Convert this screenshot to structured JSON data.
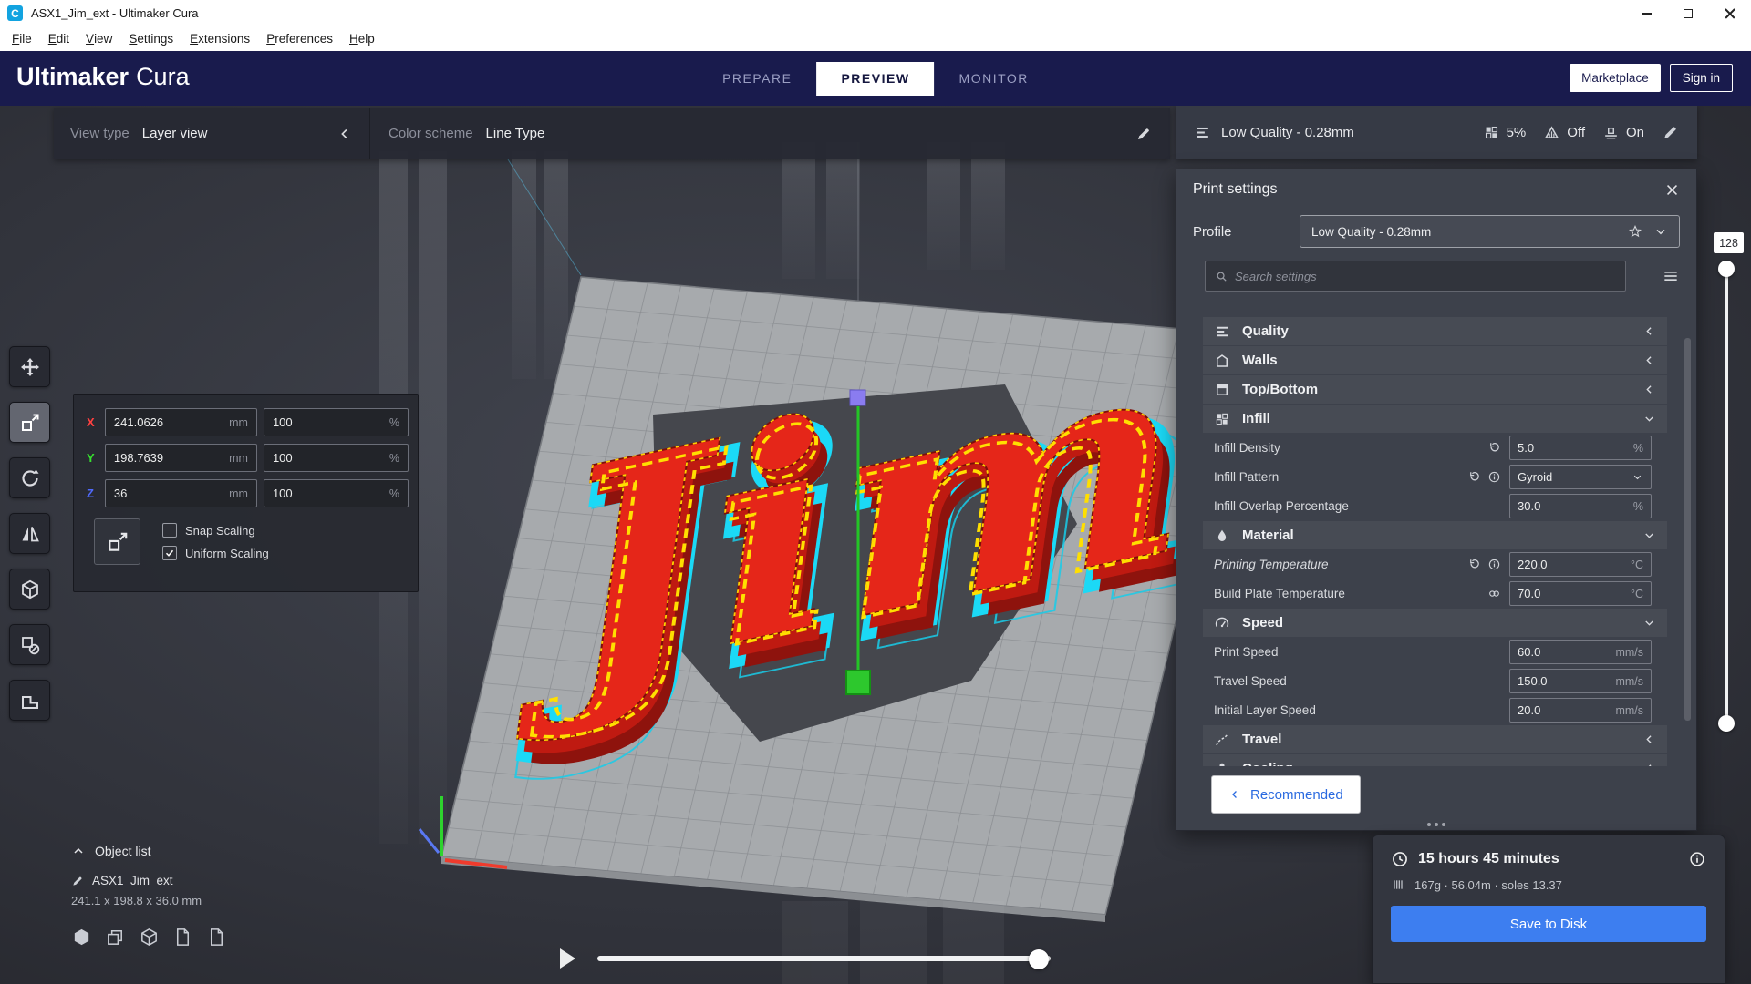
{
  "window": {
    "logo_letter": "C",
    "title": "ASX1_Jim_ext - Ultimaker Cura"
  },
  "menubar": {
    "items": [
      "File",
      "Edit",
      "View",
      "Settings",
      "Extensions",
      "Preferences",
      "Help"
    ]
  },
  "header": {
    "brand_bold": "Ultimaker",
    "brand_regular": "Cura",
    "tabs": [
      {
        "label": "PREPARE",
        "active": false
      },
      {
        "label": "PREVIEW",
        "active": true
      },
      {
        "label": "MONITOR",
        "active": false
      }
    ],
    "marketplace_label": "Marketplace",
    "signin_label": "Sign in"
  },
  "view_bar": {
    "view_type_label": "View type",
    "view_type_value": "Layer view",
    "color_scheme_label": "Color scheme",
    "color_scheme_value": "Line Type"
  },
  "printer_bar": {
    "profile": "Low Quality - 0.28mm",
    "infill_pct": "5%",
    "support": "Off",
    "adhesion": "On"
  },
  "print_settings": {
    "title": "Print settings",
    "profile_label": "Profile",
    "profile_value": "Low Quality - 0.28mm",
    "search_placeholder": "Search settings",
    "sections": [
      {
        "icon": "quality",
        "name": "Quality",
        "expanded": false,
        "settings": []
      },
      {
        "icon": "walls",
        "name": "Walls",
        "expanded": false,
        "settings": []
      },
      {
        "icon": "topbottom",
        "name": "Top/Bottom",
        "expanded": false,
        "settings": []
      },
      {
        "icon": "infill",
        "name": "Infill",
        "expanded": true,
        "settings": [
          {
            "label": "Infill Density",
            "value": "5.0",
            "unit": "%",
            "icons": [
              "revert"
            ]
          },
          {
            "label": "Infill Pattern",
            "value": "Gyroid",
            "type": "select",
            "icons": [
              "revert",
              "info"
            ]
          },
          {
            "label": "Infill Overlap Percentage",
            "value": "30.0",
            "unit": "%",
            "icons": []
          }
        ]
      },
      {
        "icon": "material",
        "name": "Material",
        "expanded": true,
        "settings": [
          {
            "label": "Printing Temperature",
            "value": "220.0",
            "unit": "°C",
            "italic": true,
            "icons": [
              "revert",
              "info"
            ]
          },
          {
            "label": "Build Plate Temperature",
            "value": "70.0",
            "unit": "°C",
            "icons": [
              "link"
            ]
          }
        ]
      },
      {
        "icon": "speed",
        "name": "Speed",
        "expanded": true,
        "settings": [
          {
            "label": "Print Speed",
            "value": "60.0",
            "unit": "mm/s",
            "icons": []
          },
          {
            "label": "Travel Speed",
            "value": "150.0",
            "unit": "mm/s",
            "icons": []
          },
          {
            "label": "Initial Layer Speed",
            "value": "20.0",
            "unit": "mm/s",
            "icons": []
          }
        ]
      },
      {
        "icon": "travel",
        "name": "Travel",
        "expanded": false,
        "settings": []
      },
      {
        "icon": "cooling",
        "name": "Cooling",
        "expanded": false,
        "settings": []
      }
    ],
    "recommended_label": "Recommended"
  },
  "toolbar": {
    "tools": [
      {
        "name": "move",
        "active": false
      },
      {
        "name": "scale",
        "active": true
      },
      {
        "name": "rotate",
        "active": false
      },
      {
        "name": "mirror",
        "active": false
      },
      {
        "name": "per-model-settings",
        "active": false
      },
      {
        "name": "support-blocker",
        "active": false
      },
      {
        "name": "lay-flat",
        "active": false
      }
    ]
  },
  "scale_tool": {
    "axes": [
      {
        "axis": "X",
        "value": "241.0626",
        "unit": "mm",
        "percent": "100",
        "percent_unit": "%"
      },
      {
        "axis": "Y",
        "value": "198.7639",
        "unit": "mm",
        "percent": "100",
        "percent_unit": "%"
      },
      {
        "axis": "Z",
        "value": "36",
        "unit": "mm",
        "percent": "100",
        "percent_unit": "%"
      }
    ],
    "snap_label": "Snap Scaling",
    "snap_checked": false,
    "uniform_label": "Uniform Scaling",
    "uniform_checked": true
  },
  "object_list": {
    "label": "Object list",
    "item_name": "ASX1_Jim_ext",
    "dimensions": "241.1 x 198.8 x 36.0 mm"
  },
  "job": {
    "duration": "15 hours 45 minutes",
    "material_info": "167g · 56.04m · soles 13.37",
    "save_label": "Save to Disk"
  },
  "layer_slider": {
    "current_label": "128"
  },
  "viewport": {
    "model_text": "Jim"
  },
  "colors": {
    "accent_blue": "#2a6ae0",
    "save_button": "#3d7ef0",
    "header_navy": "#191b4d",
    "axis_x": "#ff4040",
    "axis_y": "#36e12e",
    "axis_z": "#4f69fb",
    "model_red": "#e52619",
    "model_yellow": "#ffdf00",
    "model_outline_cyan": "#1bd9f6"
  }
}
